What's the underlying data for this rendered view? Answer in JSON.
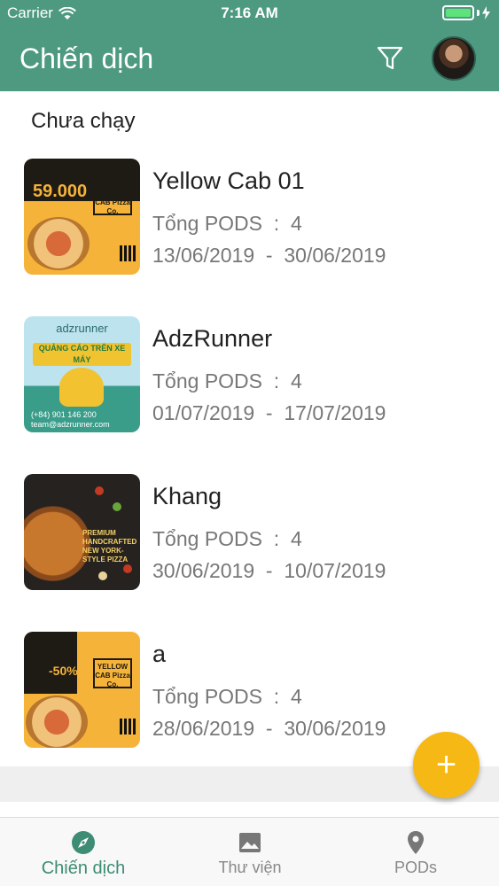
{
  "status_bar": {
    "carrier": "Carrier",
    "time": "7:16 AM"
  },
  "app_bar": {
    "title": "Chiến dịch",
    "filter_icon": "filter-icon",
    "avatar": "user-avatar"
  },
  "section": {
    "label": "Chưa chạy"
  },
  "campaigns": [
    {
      "name": "Yellow Cab 01",
      "pods_label": "Tổng PODS",
      "pods_count": "4",
      "start": "13/06/2019",
      "end": "30/06/2019",
      "thumb": {
        "price": "59.000",
        "logo": "YELLOW CAB Pizza Co."
      }
    },
    {
      "name": "AdzRunner",
      "pods_label": "Tổng PODS",
      "pods_count": "4",
      "start": "01/07/2019",
      "end": "17/07/2019",
      "thumb": {
        "brand": "adzrunner",
        "banner": "QUẢNG CÁO TRÊN XE MÁY",
        "phone": "(+84) 901 146 200",
        "email": "team@adzrunner.com"
      }
    },
    {
      "name": "Khang",
      "pods_label": "Tổng PODS",
      "pods_count": "4",
      "start": "30/06/2019",
      "end": "10/07/2019",
      "thumb": {
        "text": "PREMIUM HANDCRAFTED NEW YORK-STYLE PIZZA"
      }
    },
    {
      "name": "a",
      "pods_label": "Tổng PODS",
      "pods_count": "4",
      "start": "28/06/2019",
      "end": "30/06/2019",
      "thumb": {
        "price": "-50%",
        "logo": "YELLOW CAB Pizza Co."
      }
    }
  ],
  "fab": {
    "label": "+"
  },
  "tabs": [
    {
      "label": "Chiến dịch",
      "icon": "compass-icon",
      "active": true
    },
    {
      "label": "Thư viện",
      "icon": "image-icon",
      "active": false
    },
    {
      "label": "PODs",
      "icon": "location-pin-icon",
      "active": false
    }
  ],
  "colors": {
    "primary": "#4e9a80",
    "accent": "#f6b815",
    "active_tab": "#3d8c73"
  }
}
